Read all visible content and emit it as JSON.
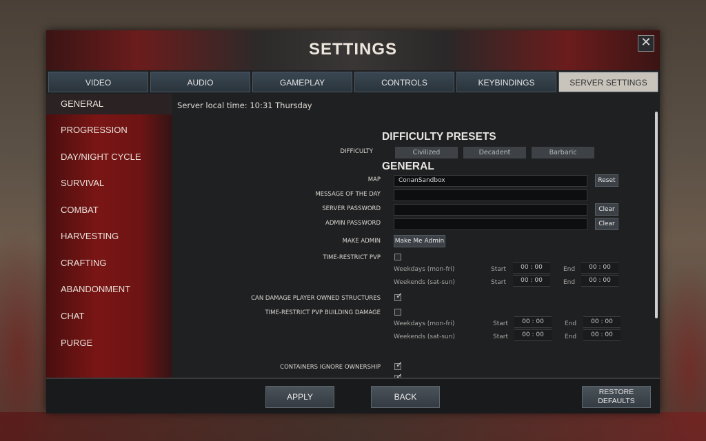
{
  "window": {
    "title": "SETTINGS",
    "close_label": "✕"
  },
  "tabs": [
    {
      "label": "VIDEO"
    },
    {
      "label": "AUDIO"
    },
    {
      "label": "GAMEPLAY"
    },
    {
      "label": "CONTROLS"
    },
    {
      "label": "KEYBINDINGS"
    },
    {
      "label": "SERVER SETTINGS",
      "active": true
    }
  ],
  "sidebar": {
    "items": [
      {
        "label": "GENERAL"
      },
      {
        "label": "PROGRESSION"
      },
      {
        "label": "DAY/NIGHT CYCLE"
      },
      {
        "label": "SURVIVAL"
      },
      {
        "label": "COMBAT"
      },
      {
        "label": "HARVESTING"
      },
      {
        "label": "CRAFTING"
      },
      {
        "label": "ABANDONMENT"
      },
      {
        "label": "CHAT"
      },
      {
        "label": "PURGE"
      }
    ]
  },
  "content": {
    "local_time": "Server local time: 10:31  Thursday",
    "presets_heading": "DIFFICULTY PRESETS",
    "difficulty_label": "DIFFICULTY",
    "presets": [
      "Civilized",
      "Decadent",
      "Barbaric"
    ],
    "general_heading": "GENERAL",
    "map_label": "MAP",
    "map_value": "ConanSandbox",
    "reset_label": "Reset",
    "motd_label": "MESSAGE OF THE DAY",
    "motd_value": "",
    "server_password_label": "SERVER PASSWORD",
    "admin_password_label": "ADMIN PASSWORD",
    "clear_label": "Clear",
    "make_admin_label": "MAKE ADMIN",
    "make_admin_button": "Make Me Admin",
    "time_restrict_pvp_label": "TIME-RESTRICT PVP",
    "weekdays_label": "Weekdays (mon-fri)",
    "weekends_label": "Weekends (sat-sun)",
    "start_label": "Start",
    "end_label": "End",
    "time_value": "00 : 00",
    "can_damage_label": "CAN DAMAGE PLAYER OWNED STRUCTURES",
    "time_restrict_building_label": "TIME-RESTRICT PVP BUILDING DAMAGE",
    "containers_label": "CONTAINERS IGNORE OWNERSHIP",
    "checkboxes": {
      "time_restrict_pvp": false,
      "can_damage_structures": true,
      "time_restrict_building": false,
      "containers_ignore_ownership": true
    }
  },
  "footer": {
    "apply_label": "APPLY",
    "back_label": "BACK",
    "restore_label_line1": "RESTORE",
    "restore_label_line2": "DEFAULTS"
  }
}
